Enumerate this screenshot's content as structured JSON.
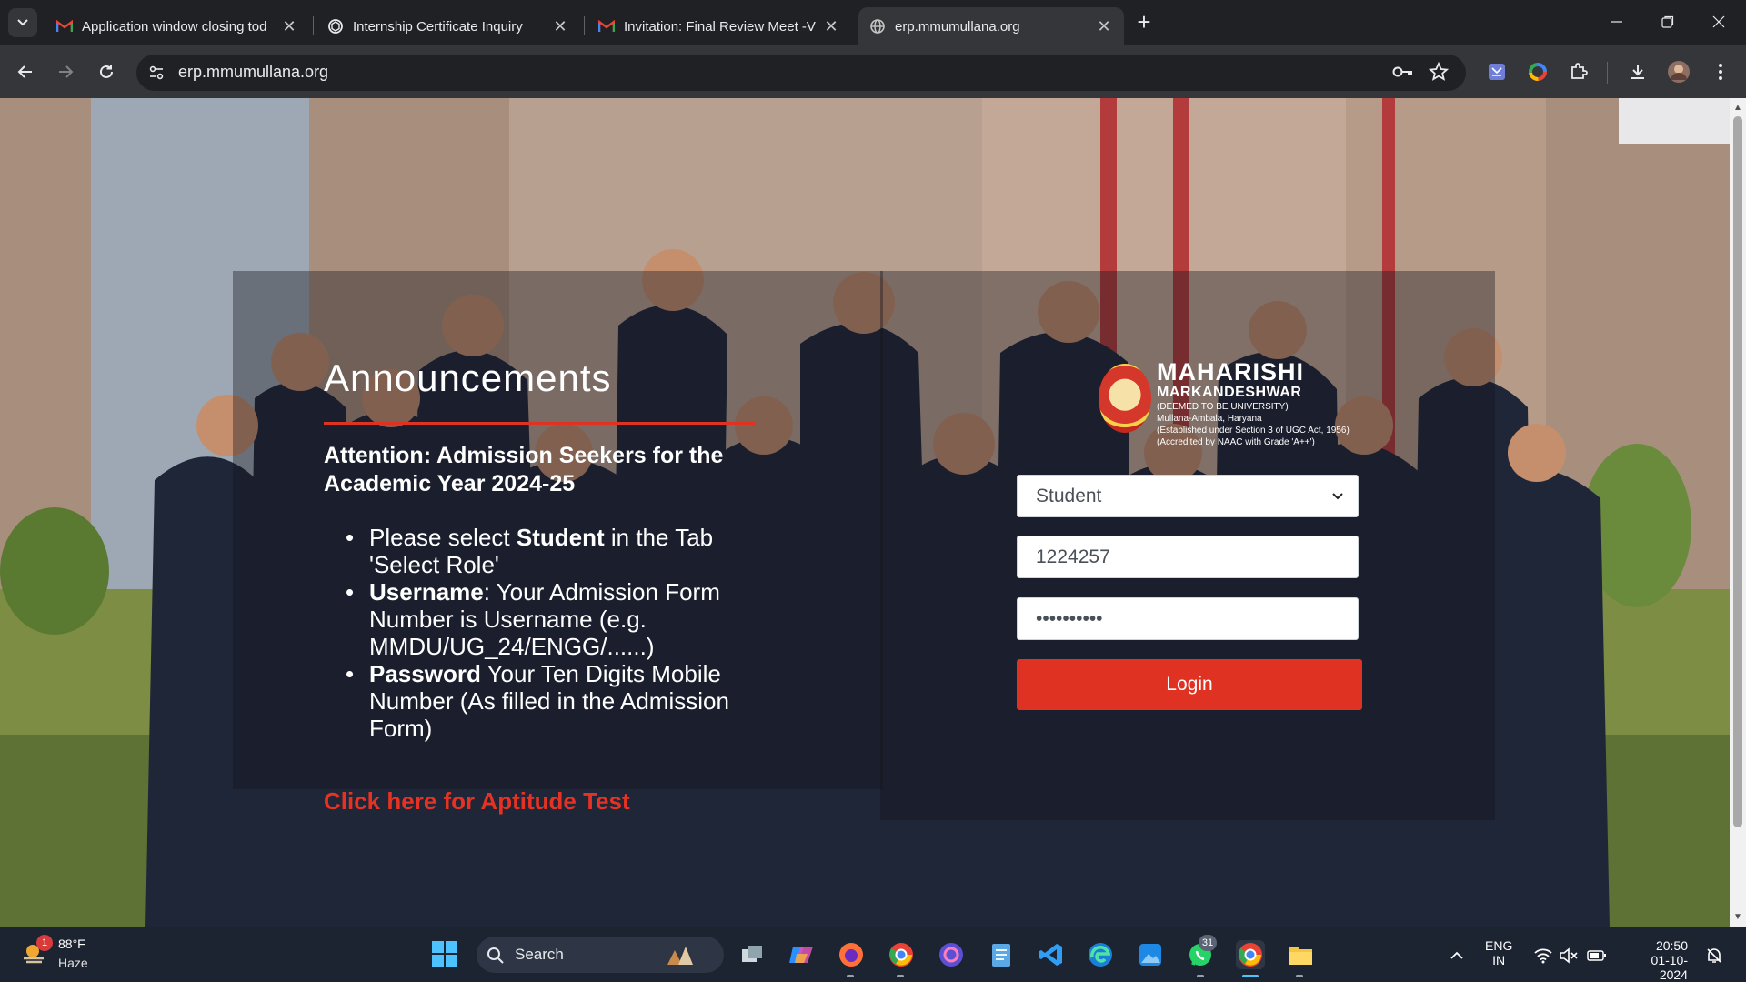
{
  "browser": {
    "tabs": [
      {
        "title": "Application window closing tod",
        "favicon": "gmail-icon"
      },
      {
        "title": "Internship Certificate Inquiry",
        "favicon": "chatgpt-icon"
      },
      {
        "title": "Invitation: Final Review Meet -V",
        "favicon": "gmail-icon"
      },
      {
        "title": "erp.mmumullana.org",
        "favicon": "globe-icon"
      }
    ],
    "url": "erp.mmumullana.org"
  },
  "announcements": {
    "title": "Announcements",
    "heading": "Attention: Admission Seekers for the Academic Year 2024-25",
    "items": [
      {
        "pre": "Please select ",
        "bold": "Student",
        "post": " in the Tab 'Select Role'"
      },
      {
        "pre": "",
        "bold": "Username",
        "post": ": Your Admission Form Number is Username (e.g. MMDU/UG_24/ENGG/......)"
      },
      {
        "pre": "",
        "bold": "Password",
        "post": " Your Ten Digits Mobile Number (As filled in the Admission Form)"
      }
    ],
    "aptitude_link": "Click here for Aptitude Test"
  },
  "logo": {
    "line1": "MAHARISHI",
    "line2": "MARKANDESHWAR",
    "line3": "(DEEMED TO BE UNIVERSITY)",
    "line4": "Mullana-Ambala, Haryana",
    "line5": "(Established under Section 3 of UGC Act, 1956)",
    "line6": "(Accredited by NAAC with Grade 'A++')"
  },
  "login": {
    "role": "Student",
    "username": "1224257",
    "password": "••••••••••",
    "button": "Login"
  },
  "taskbar": {
    "weather_badge": "1",
    "temperature": "88°F",
    "weather": "Haze",
    "search": "Search",
    "whatsapp_badge": "31",
    "lang_line1": "ENG",
    "lang_line2": "IN",
    "time": "20:50",
    "date": "01-10-2024"
  },
  "colors": {
    "accent_red": "#e03222",
    "chrome_dark": "#202124",
    "taskbar": "#1c2331"
  }
}
